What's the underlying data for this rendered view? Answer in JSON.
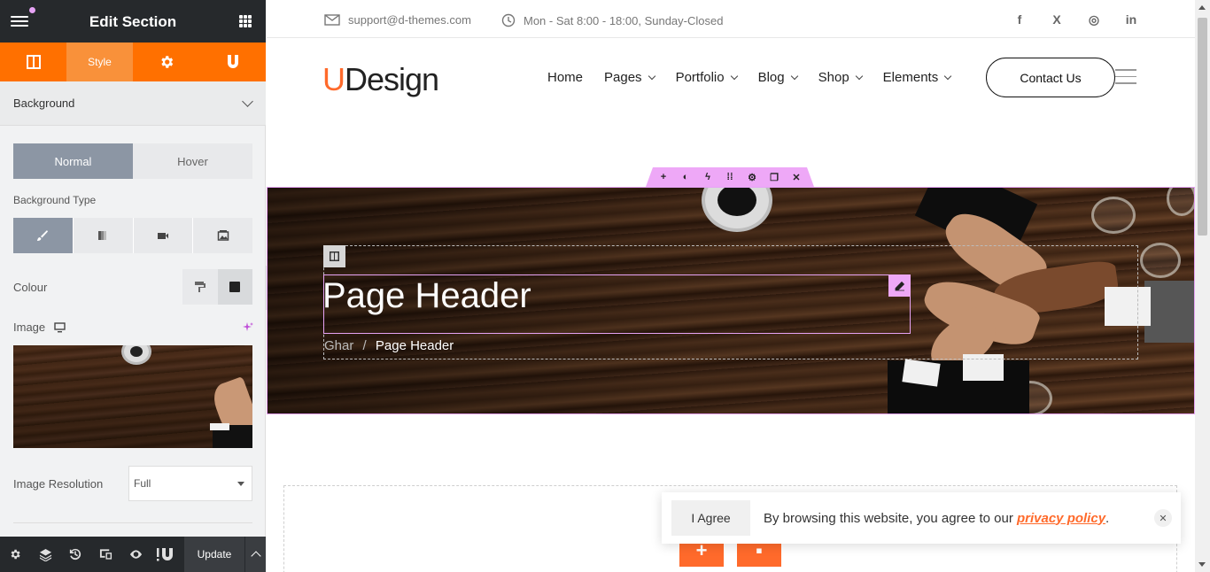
{
  "panel": {
    "title": "Edit Section",
    "tabs": [
      {
        "icon": "layout-icon",
        "label": ""
      },
      {
        "icon": "",
        "label": "Style"
      },
      {
        "icon": "gear-icon",
        "label": ""
      },
      {
        "icon": "udesign-icon",
        "label": ""
      }
    ],
    "section_title": "Background",
    "states": [
      "Normal",
      "Hover"
    ],
    "background_type_label": "Background Type",
    "background_types": [
      "classic-brush-icon",
      "gradient-icon",
      "video-icon",
      "slideshow-icon"
    ],
    "colour_label": "Colour",
    "image_label": "Image",
    "image_resolution_label": "Image Resolution",
    "image_resolution_value": "Full",
    "footer": {
      "update_label": "Update",
      "icons": [
        "gear-icon",
        "layers-icon",
        "history-icon",
        "responsive-icon",
        "eye-icon",
        "udesign-builder-icon"
      ]
    }
  },
  "site": {
    "topbar": {
      "email": "support@d-themes.com",
      "hours": "Mon - Sat 8:00 - 18:00, Sunday-Closed",
      "social": [
        "f",
        "X",
        "◎",
        "in"
      ]
    },
    "logo": {
      "u": "U",
      "rest": "Design"
    },
    "nav": [
      {
        "label": "Home",
        "dropdown": false
      },
      {
        "label": "Pages",
        "dropdown": true
      },
      {
        "label": "Portfolio",
        "dropdown": true
      },
      {
        "label": "Blog",
        "dropdown": true
      },
      {
        "label": "Shop",
        "dropdown": true
      },
      {
        "label": "Elements",
        "dropdown": true
      }
    ],
    "contact_label": "Contact Us",
    "section_tools": [
      "+",
      "◐",
      "ϟ",
      "⁞⁞",
      "⚙",
      "❐",
      "✕"
    ],
    "hero": {
      "heading": "Page Header",
      "breadcrumb_home": "Ghar",
      "breadcrumb_sep": "/",
      "breadcrumb_current": "Page Header"
    },
    "add_buttons": [
      "+",
      "▪"
    ],
    "cookie": {
      "agree": "I Agree",
      "message": "By browsing this website, you agree to our ",
      "link": "privacy policy",
      "suffix": ".",
      "close": "✕"
    }
  },
  "colors": {
    "accent": "#ff7000",
    "brand_orange": "#ff6a2b",
    "editor_highlight": "#eea8f7",
    "panel_dark": "#26292c"
  }
}
